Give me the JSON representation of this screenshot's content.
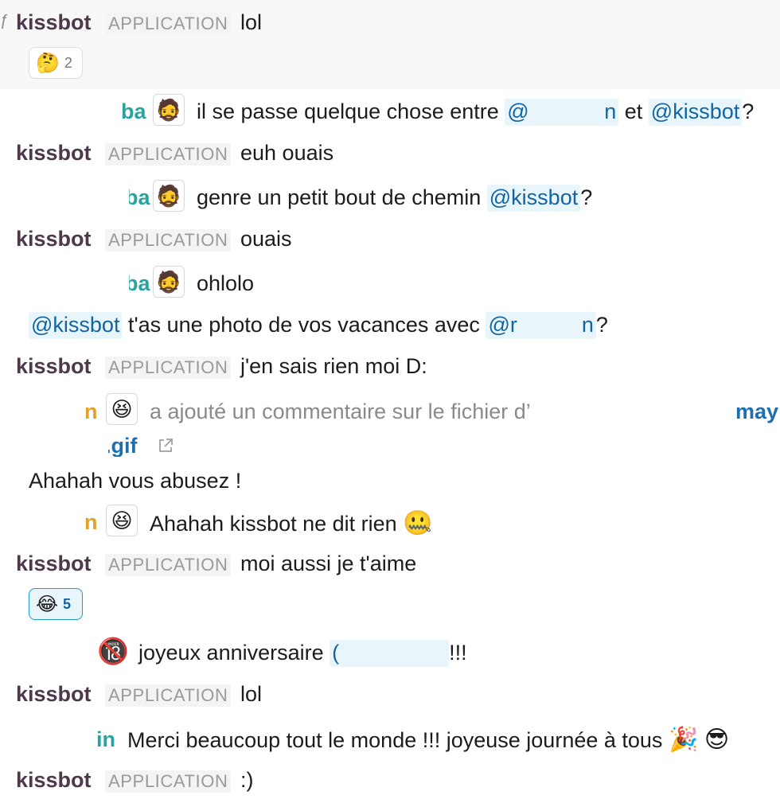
{
  "badge": "APPLICATION",
  "m1": {
    "cut": "ƒ",
    "author": "kissbot",
    "text": "lol"
  },
  "r1": {
    "emoji": "🤔",
    "count": "2"
  },
  "m2": {
    "name": "ba",
    "avatar": "🧔",
    "text": "il se passe quelque chose entre",
    "mention_a": "@",
    "mention_a_end": "n",
    "and": "et",
    "mention_b": "@kissbot",
    "end": "?"
  },
  "m3": {
    "author": "kissbot",
    "text": "euh ouais"
  },
  "m4": {
    "name": "ba",
    "avatar": "🧔",
    "text": "genre un petit bout de chemin",
    "mention": "@kissbot",
    "end": "?"
  },
  "m5": {
    "author": "kissbot",
    "text": "ouais"
  },
  "m6": {
    "name": "ba",
    "avatar": "🧔",
    "text": "ohlolo"
  },
  "m7": {
    "mention": "@kissbot",
    "text": "t'as une photo de vos vacances avec",
    "mention2": "@r",
    "mention2_end": "n",
    "end": "?"
  },
  "m8": {
    "author": "kissbot",
    "text": "j'en sais rien moi D:"
  },
  "m9": {
    "name": "n",
    "avatar": "😆",
    "text": "a ajouté un commentaire sur le fichier d’",
    "link": "may",
    "file": ".gif"
  },
  "m10": {
    "text": "Ahahah vous abusez !"
  },
  "m11": {
    "name": "n",
    "avatar": "😆",
    "text": "Ahahah kissbot ne dit rien",
    "emoji": "🤐"
  },
  "m12": {
    "author": "kissbot",
    "text": "moi aussi je t'aime"
  },
  "r2": {
    "emoji": "😂",
    "count": "5"
  },
  "m13": {
    "avatar": "🔞",
    "text": "joyeux anniversaire",
    "mention_open": "(",
    "mention_close": "!!!"
  },
  "m14": {
    "author": "kissbot",
    "text": "lol"
  },
  "m15": {
    "name": "in",
    "text": "Merci beaucoup tout le monde !!! joyeuse journée à tous",
    "emoji1": "🎉",
    "emoji2": "😎"
  },
  "m16": {
    "author": "kissbot",
    "text": ":)"
  },
  "colors": {
    "author": "#4d394b",
    "mention": "#1264a3",
    "mention_bg": "#e8f5fa",
    "teal": "#2aa3a0",
    "orange": "#e0a32a",
    "link": "#1d6fb0"
  },
  "icons": {
    "external_link": "external-link-icon"
  }
}
